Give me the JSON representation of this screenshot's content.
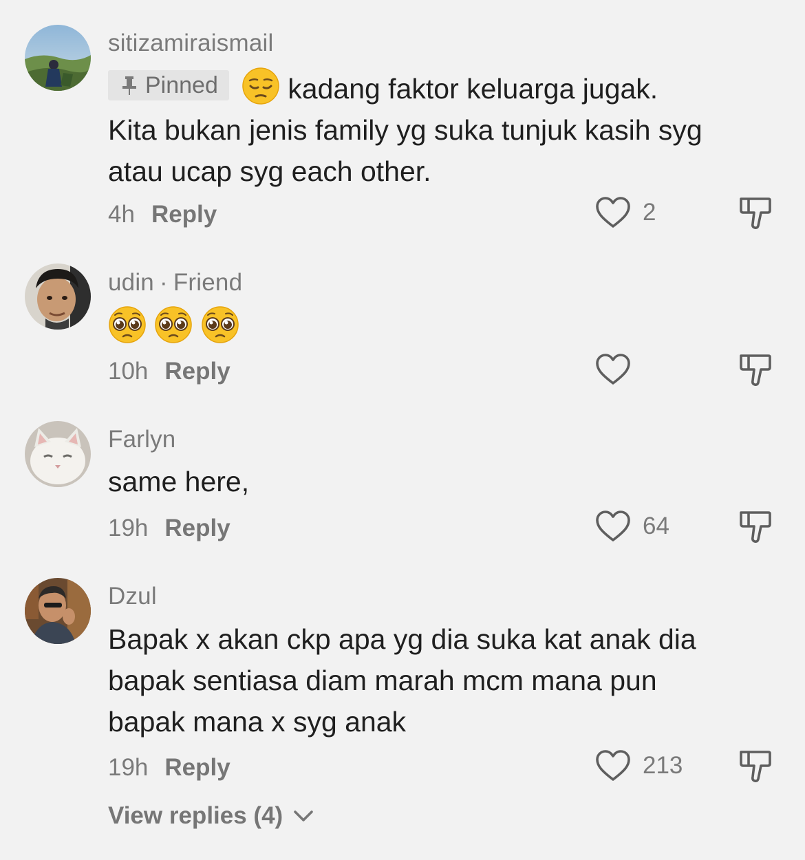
{
  "comments": [
    {
      "username": "sitizamiraismail",
      "pinned_label": "Pinned",
      "text_line1": "kadang faktor keluarga jugak.",
      "text_rest": "Kita bukan jenis family yg suka tunjuk kasih syg atau ucap syg each other.",
      "time": "4h",
      "reply_label": "Reply",
      "likes": "2"
    },
    {
      "username": "udin",
      "separator": "·",
      "friend_label": "Friend",
      "emojis": [
        "pleading-face",
        "pleading-face",
        "pleading-face"
      ],
      "time": "10h",
      "reply_label": "Reply",
      "likes": ""
    },
    {
      "username": "Farlyn",
      "text": "same here,",
      "time": "19h",
      "reply_label": "Reply",
      "likes": "64"
    },
    {
      "username": "Dzul",
      "text": "Bapak x akan ckp apa yg dia suka kat anak dia bapak sentiasa diam marah mcm mana pun bapak mana x syg anak",
      "time": "19h",
      "reply_label": "Reply",
      "likes": "213"
    }
  ],
  "view_replies_label": "View replies (4)",
  "icons": {
    "like": "heart-outline-icon",
    "dislike": "thumbs-down-icon",
    "pin": "pin-icon",
    "expand": "chevron-down-icon"
  },
  "colors": {
    "background": "#f2f2f2",
    "text": "#1f1f1f",
    "muted": "#7a7a7a",
    "pinned_bg": "#e4e4e4"
  }
}
